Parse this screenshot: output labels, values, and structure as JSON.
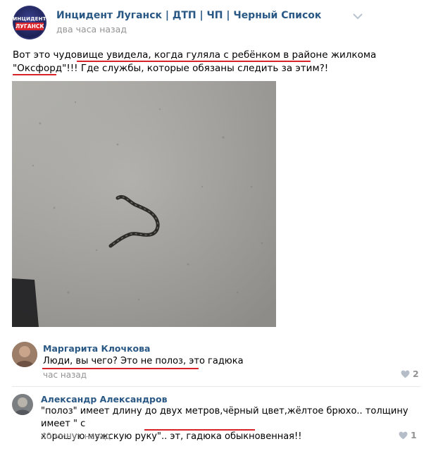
{
  "post": {
    "group_name": "Инцидент Луганск | ДТП | ЧП | Черный Список",
    "time": "два часа назад",
    "logo_top": "ИНЦИДЕНТ",
    "logo_bottom": "ЛУГАНСК",
    "text_line1": "Вот это чудовище увидела, когда гуляла с ребёнком в районе жилкома",
    "text_line2": "\"Оксфорд\"!!! Где службы, которые обязаны следить за этим?!"
  },
  "comments": [
    {
      "author": "Маргарита Клочкова",
      "text": "Люди, вы чего? Это не полоз, это гадюка",
      "time": "час назад",
      "likes": "2"
    },
    {
      "author": "Александр Александров",
      "text_line1": "\"полоз\" имеет длину до двух метров,чёрный цвет,жёлтое брюхо.. толщину имеет \" с",
      "text_line2": "хорошую мужскую руку\".. эт, гадюка обыкновенная!!",
      "time": "40 минут назад",
      "likes": "1"
    }
  ],
  "colors": {
    "link": "#2a5885",
    "muted": "#939393",
    "underline": "#d6242a",
    "logo_red": "#d8232a",
    "logo_blue": "#2a2f6e"
  },
  "icons": {
    "more": "chevron-down-icon",
    "like": "heart-icon"
  }
}
